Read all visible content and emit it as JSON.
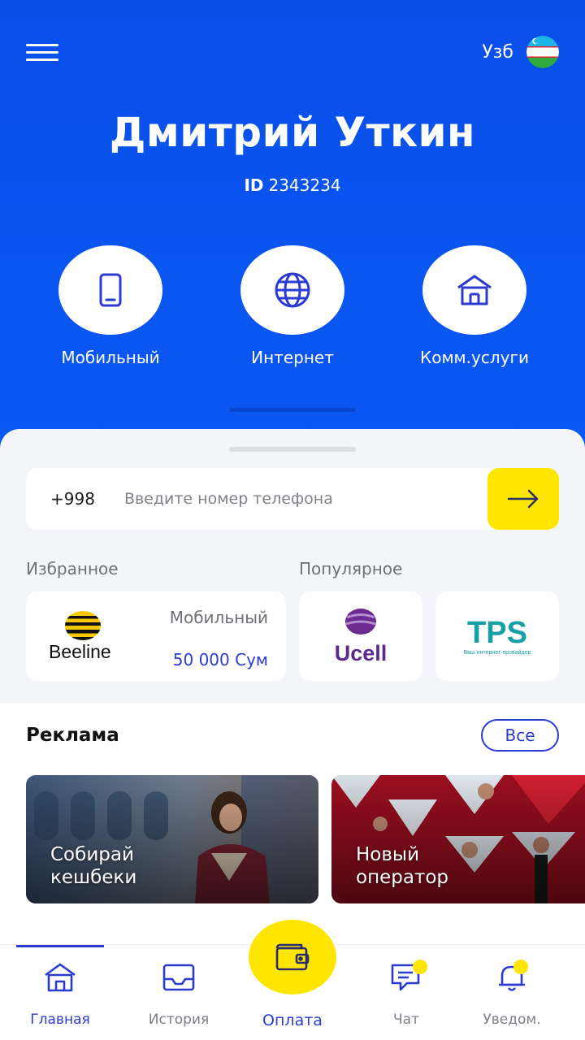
{
  "header": {
    "language_label": "Узб",
    "user_name": "Дмитрий Уткин",
    "id_prefix": "ID",
    "id_value": "2343234"
  },
  "categories": [
    {
      "label": "Мобильный",
      "icon": "phone-icon"
    },
    {
      "label": "Интернет",
      "icon": "globe-icon"
    },
    {
      "label": "Комм.услуги",
      "icon": "house-icon"
    }
  ],
  "phone": {
    "prefix": "+998",
    "placeholder": "Введите номер телефона"
  },
  "favorites": {
    "label": "Избранное",
    "items": [
      {
        "brand": "Beeline",
        "category": "Мобильный",
        "amount": "50 000 Сум"
      }
    ]
  },
  "popular": {
    "label": "Популярное",
    "items": [
      {
        "brand": "Ucell"
      },
      {
        "brand": "TPS",
        "tagline": "Ваш интернет-провайдер"
      }
    ]
  },
  "ads": {
    "title": "Реклама",
    "all_label": "Все",
    "items": [
      {
        "line1": "Собирай",
        "line2": "кешбеки"
      },
      {
        "line1": "Новый",
        "line2": "оператор"
      }
    ]
  },
  "tabs": [
    {
      "label": "Главная",
      "icon": "home-icon",
      "active": true
    },
    {
      "label": "История",
      "icon": "inbox-icon"
    },
    {
      "label": "Оплата",
      "icon": "wallet-icon"
    },
    {
      "label": "Чат",
      "icon": "chat-icon"
    },
    {
      "label": "Уведом.",
      "icon": "bell-icon"
    }
  ],
  "colors": {
    "primary": "#0b52ee",
    "accent_yellow": "#ffe600",
    "link_blue": "#2b3bd0"
  }
}
